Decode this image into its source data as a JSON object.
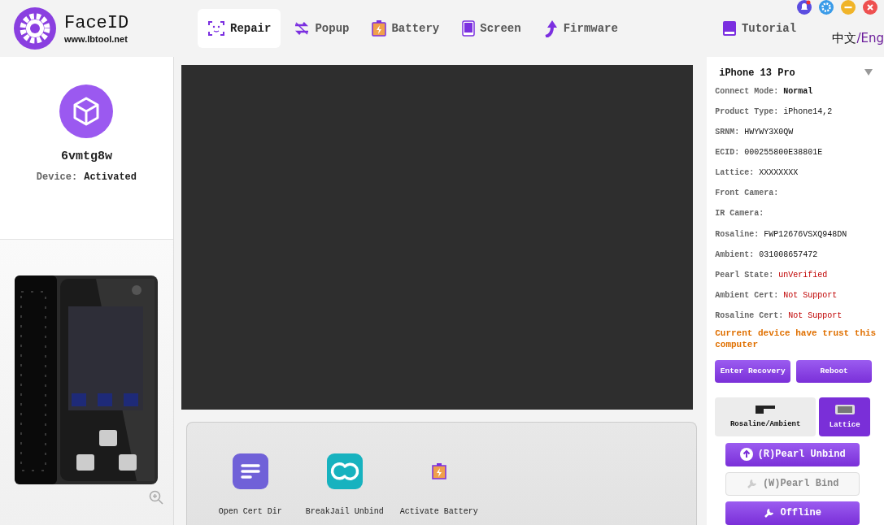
{
  "app": {
    "name": "FaceID",
    "website": "www.lbtool.net"
  },
  "nav_tabs": [
    {
      "label": "Repair",
      "selected": true
    },
    {
      "label": "Popup",
      "selected": false
    },
    {
      "label": "Battery",
      "selected": false
    },
    {
      "label": "Screen",
      "selected": false
    },
    {
      "label": "Firmware",
      "selected": false
    },
    {
      "label": "Tutorial",
      "selected": false
    }
  ],
  "language": {
    "separator": "/",
    "options": [
      {
        "label": "中文",
        "selected": false
      },
      {
        "label": "Eng",
        "selected": true
      }
    ]
  },
  "device": {
    "name": "6vmtg8w",
    "status_label": "Device:",
    "status": "Activated"
  },
  "device_photo": {
    "kind": "picture"
  },
  "model_picker": {
    "value": "iPhone 13 Pro"
  },
  "info": [
    {
      "label": "Connect Mode:",
      "value": "Normal",
      "alert": false
    },
    {
      "label": "Product Type:",
      "value": "iPhone14,2",
      "alert": false
    },
    {
      "label": "SRNM:",
      "value": "HWYWY3X0QW",
      "alert": false
    },
    {
      "label": "ECID:",
      "value": "000255800E38801E",
      "alert": false
    },
    {
      "label": "Lattice:",
      "value": "XXXXXXXX",
      "alert": false
    },
    {
      "label": "Front Camera:"
    },
    {
      "label": "IR Camera:"
    },
    {
      "label": "Rosaline:",
      "value": "FWP12676VSXQ948DN",
      "alert": false
    },
    {
      "label": "Ambient:",
      "value": "031008657472",
      "alert": false
    },
    {
      "label": "Pearl State:",
      "value": "unVerified",
      "alert": true
    },
    {
      "label": "Ambient Cert:",
      "value": "Not Support",
      "alert": true
    },
    {
      "label": "Rosaline Cert:",
      "value": "Not Support",
      "alert": true
    }
  ],
  "trust_message": "Current device have trust this computer",
  "buttons": [
    "Enter Recovery",
    "Reboot"
  ],
  "sensor_tabs": [
    {
      "label": "Rosaline/Ambient",
      "selected": false
    },
    {
      "label": "Lattice",
      "selected": true
    }
  ],
  "actions": [
    {
      "label": "(R)Pearl Unbind",
      "disabled": false
    },
    {
      "label": "(W)Pearl Bind",
      "disabled": true
    },
    {
      "label": "Offline",
      "disabled": false
    }
  ],
  "tools": [
    {
      "label": "Open Cert Dir"
    },
    {
      "label": "BreakJail Unbind"
    },
    {
      "label": "Activate Battery"
    }
  ]
}
